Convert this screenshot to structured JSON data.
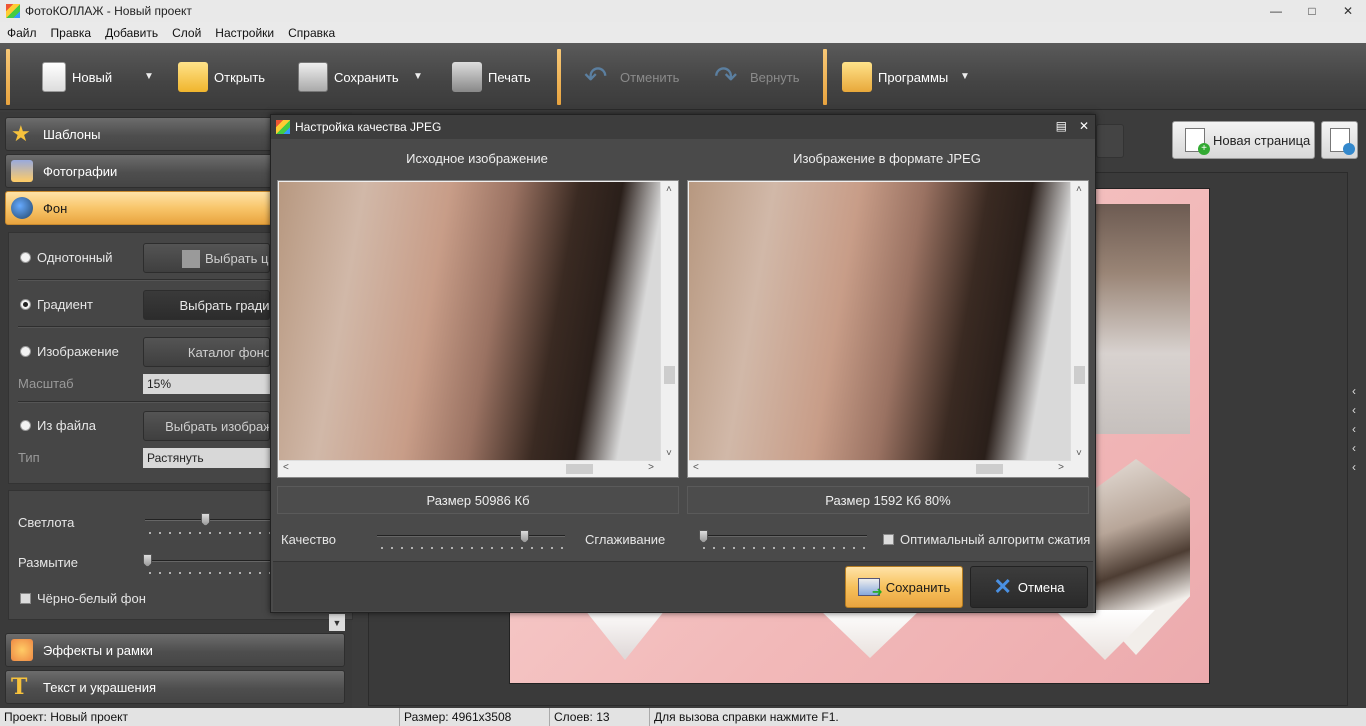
{
  "window": {
    "title": "ФотоКОЛЛАЖ - Новый проект"
  },
  "menu": [
    "Файл",
    "Правка",
    "Добавить",
    "Слой",
    "Настройки",
    "Справка"
  ],
  "toolbar": {
    "new_label": "Новый",
    "open_label": "Открыть",
    "save_label": "Сохранить",
    "print_label": "Печать",
    "undo_label": "Отменить",
    "redo_label": "Вернуть",
    "programs_label": "Программы"
  },
  "sidebar": {
    "templates": "Шаблоны",
    "photos": "Фотографии",
    "background": "Фон",
    "effects": "Эффекты и рамки",
    "text": "Текст и украшения"
  },
  "background_panel": {
    "solid_label": "Однотонный",
    "solid_button": "Выбрать цв",
    "gradient_label": "Градиент",
    "gradient_button": "Выбрать гради",
    "image_label": "Изображение",
    "image_button": "Каталог фоно",
    "scale_label": "Масштаб",
    "scale_value": "15%",
    "file_label": "Из файла",
    "file_button": "Выбрать изображ",
    "type_label": "Тип",
    "type_value": "Растянуть",
    "brightness_label": "Светлота",
    "blur_label": "Размытие",
    "bw_label": "Чёрно-белый фон",
    "selected_option": "Градиент"
  },
  "workspace": {
    "new_page_label": "Новая страница"
  },
  "dialog": {
    "title": "Настройка качества JPEG",
    "original_caption": "Исходное изображение",
    "jpeg_caption": "Изображение в формате JPEG",
    "original_size": "Размер 50986 Кб",
    "jpeg_size": "Размер 1592 Кб 80%",
    "quality_label": "Качество",
    "smoothing_label": "Сглаживание",
    "optimal_label": "Оптимальный алгоритм сжатия",
    "save_button": "Сохранить",
    "cancel_button": "Отмена",
    "quality_value": 0.8,
    "smoothing_value": 0.0
  },
  "status": {
    "project_label": "Проект:",
    "project_value": "Новый проект",
    "size_label": "Размер:",
    "size_value": "4961x3508",
    "layers_label": "Слоев:",
    "layers_value": "13",
    "help_text": "Для вызова справки нажмите F1."
  },
  "colors": {
    "accent": "#f7c15c",
    "toolbar_bg": "#4a4a4a",
    "panel_bg": "#464646"
  }
}
